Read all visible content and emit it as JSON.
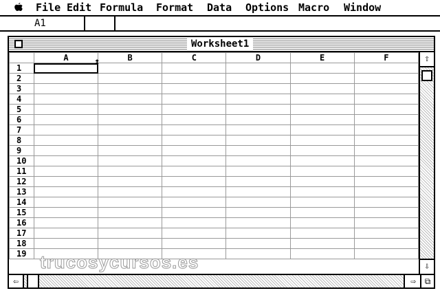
{
  "menubar": {
    "apple_icon": "apple-icon",
    "items": [
      "File",
      "Edit",
      "Formula",
      "Format",
      "Data",
      "Options",
      "Macro",
      "Window"
    ]
  },
  "formula_bar": {
    "cell_reference": "A1",
    "content": ""
  },
  "window": {
    "title": "Worksheet1",
    "columns": [
      "A",
      "B",
      "C",
      "D",
      "E",
      "F"
    ],
    "rows": [
      "1",
      "2",
      "3",
      "4",
      "5",
      "6",
      "7",
      "8",
      "9",
      "10",
      "11",
      "12",
      "13",
      "14",
      "15",
      "16",
      "17",
      "18",
      "19"
    ],
    "selected_cell": "A1"
  },
  "watermark": "trucosycursos.es"
}
